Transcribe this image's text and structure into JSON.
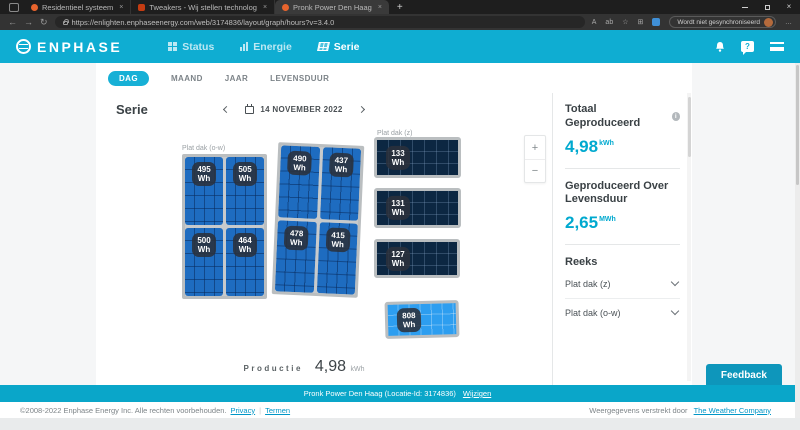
{
  "icons": {
    "close": "×",
    "plus": "+",
    "minus": "−",
    "more": "…",
    "back": "←",
    "forward": "→",
    "refresh": "↻",
    "read_aloud": "A",
    "translate": "ab",
    "star": "☆",
    "collections": "⊞",
    "info": "i",
    "help": "?"
  },
  "browser": {
    "tabs": [
      {
        "title": "Residentieel systeem"
      },
      {
        "title": "Tweakers - Wij stellen technolog"
      },
      {
        "title": "Pronk Power Den Haag"
      }
    ],
    "url": "https://enlighten.enphaseenergy.com/web/3174836/layout/graph/hours?v=3.4.0",
    "sync_label": "Wordt niet gesynchroniseerd"
  },
  "app_header": {
    "brand": "ENPHASE",
    "nav": [
      {
        "label": "Status"
      },
      {
        "label": "Energie"
      },
      {
        "label": "Serie"
      }
    ]
  },
  "period_tabs": [
    "DAG",
    "MAAND",
    "JAAR",
    "LEVENSDUUR"
  ],
  "main": {
    "title": "Serie",
    "date": "14 NOVEMBER 2022"
  },
  "layout": {
    "unit": "Wh",
    "group_ow": {
      "label": "Plat dak (o-w)",
      "a1": {
        "p1": "495",
        "p2": "505",
        "p3": "500",
        "p4": "464"
      },
      "a2": {
        "p1": "490",
        "p2": "437",
        "p3": "478",
        "p4": "415"
      }
    },
    "group_z": {
      "label": "Plat dak (z)",
      "p1": "133",
      "p2": "131",
      "p3": "127",
      "p4": "808"
    }
  },
  "production": {
    "label": "Productie",
    "value": "4,98",
    "unit": "kWh"
  },
  "sidebar": {
    "total_label": "Totaal Geproduceerd",
    "total_value": "4,98",
    "total_unit": "kWh",
    "lifetime_label": "Geproduceerd Over Levensduur",
    "lifetime_value": "2,65",
    "lifetime_unit": "MWh",
    "series_label": "Reeks",
    "series": [
      {
        "name": "Plat dak (z)"
      },
      {
        "name": "Plat dak (o-w)"
      }
    ]
  },
  "feedback_label": "Feedback",
  "site_bar": {
    "text": "Pronk Power Den Haag (Locatie-Id: 3174836)",
    "link": "Wijzigen"
  },
  "footer": {
    "copyright": "©2008-2022 Enphase Energy Inc. Alle rechten voorbehouden.",
    "privacy": "Privacy",
    "sep": "|",
    "terms": "Termen",
    "weather_prefix": "Weergegevens verstrekt door ",
    "weather_link": "The Weather Company"
  }
}
